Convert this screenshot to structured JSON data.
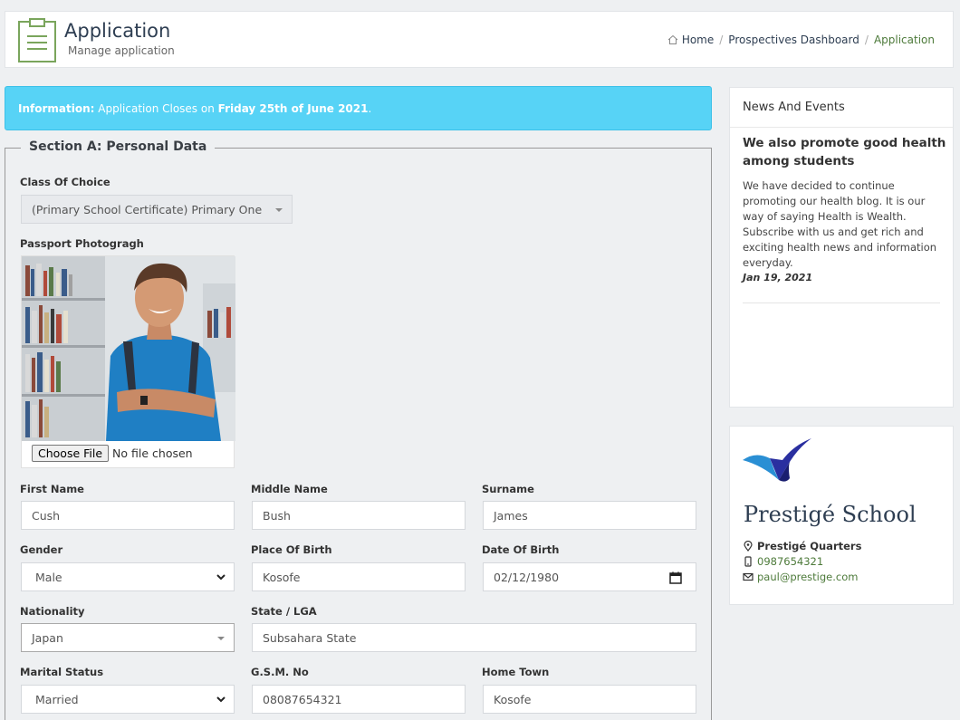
{
  "header": {
    "title": "Application",
    "subtitle": "Manage application",
    "breadcrumb": {
      "home": "Home",
      "dashboard": "Prospectives Dashboard",
      "current": "Application"
    }
  },
  "info": {
    "label": "Information:",
    "text": " Application Closes on ",
    "date": "Friday 25th of June 2021",
    "end": "."
  },
  "section": {
    "title": "Section A: Personal Data",
    "class_choice": {
      "label": "Class Of Choice",
      "value": "(Primary School Certificate) Primary One"
    },
    "passport": {
      "label": "Passport Photogragh",
      "button": "Choose File",
      "status": "No file chosen"
    },
    "first_name": {
      "label": "First Name",
      "value": "Cush"
    },
    "middle_name": {
      "label": "Middle Name",
      "value": "Bush"
    },
    "surname": {
      "label": "Surname",
      "value": "James"
    },
    "gender": {
      "label": "Gender",
      "value": "Male"
    },
    "place_of_birth": {
      "label": "Place Of Birth",
      "value": "Kosofe"
    },
    "date_of_birth": {
      "label": "Date Of Birth",
      "value": "02/12/1980"
    },
    "nationality": {
      "label": "Nationality",
      "value": "Japan"
    },
    "state_lga": {
      "label": "State / LGA",
      "value": "Subsahara State"
    },
    "marital_status": {
      "label": "Marital Status",
      "value": "Married"
    },
    "gsm": {
      "label": "G.S.M. No",
      "value": "08087654321"
    },
    "home_town": {
      "label": "Home Town",
      "value": "Kosofe"
    }
  },
  "news": {
    "heading": "News And Events",
    "title": "We also promote good health among students",
    "body": "We have decided to continue promoting our health blog. It is our way of saying Health is Wealth. Subscribe with us and get rich and exciting health news and information everyday.",
    "date": "Jan 19, 2021"
  },
  "school": {
    "name": "Prestigé School",
    "address": "Prestigé Quarters",
    "phone": "0987654321",
    "email": "paul@prestige.com"
  },
  "colors": {
    "info_bg": "#57d3f6",
    "link_green": "#4d7a3a",
    "title_navy": "#2e3e52"
  },
  "icons": [
    "clipboard-icon",
    "home-icon",
    "chevron-down-icon",
    "calendar-icon",
    "map-pin-icon",
    "phone-icon",
    "mail-icon",
    "checkmark-logo"
  ]
}
